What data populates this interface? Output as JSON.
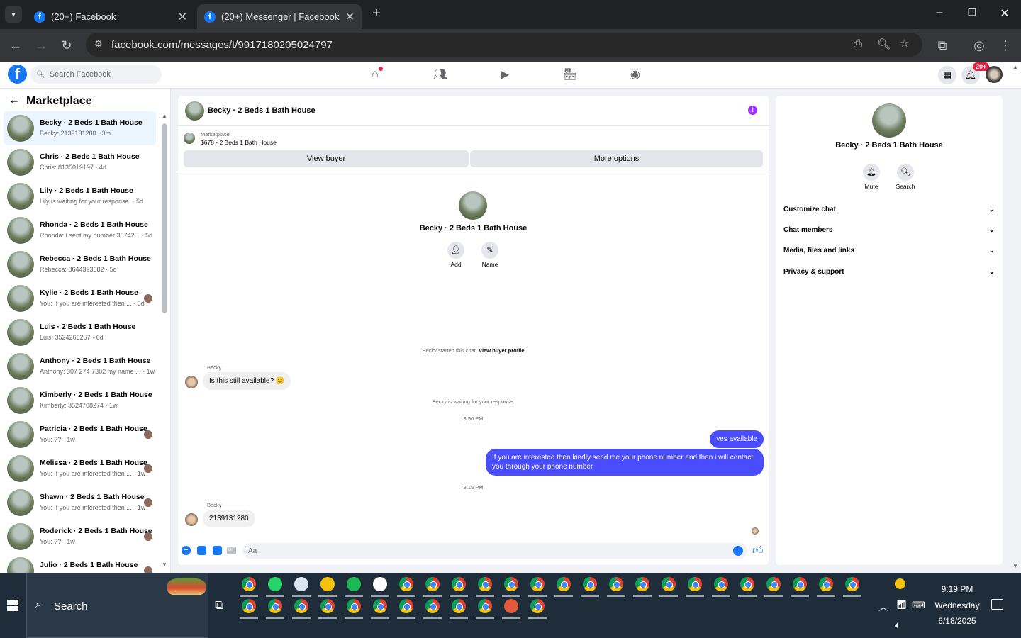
{
  "browser": {
    "tabs": [
      {
        "title": "(20+) Facebook",
        "active": false
      },
      {
        "title": "(20+) Messenger | Facebook",
        "active": true
      }
    ],
    "url": "facebook.com/messages/t/9917180205024797"
  },
  "header": {
    "search_placeholder": "Search Facebook",
    "notification_badge": "20+"
  },
  "sidebar": {
    "title": "Marketplace",
    "conversations": [
      {
        "name": "Becky · 2 Beds 1 Bath House",
        "preview": "Becky: 2139131280 · 3m",
        "selected": true
      },
      {
        "name": "Chris · 2 Beds 1 Bath House",
        "preview": "Chris: 8135019197 · 4d"
      },
      {
        "name": "Lily · 2 Beds 1 Bath House",
        "preview": "Lily is waiting for your response. · 5d"
      },
      {
        "name": "Rhonda · 2 Beds 1 Bath House",
        "preview": "Rhonda: I sent my number 30742... · 5d"
      },
      {
        "name": "Rebecca · 2 Beds 1 Bath House",
        "preview": "Rebecca: 8644323682 · 5d"
      },
      {
        "name": "Kylie · 2 Beds 1 Bath House",
        "preview": "You: If you are interested then ... · 5d",
        "seen": true
      },
      {
        "name": "Luis · 2 Beds 1 Bath House",
        "preview": "Luis: 3524266257 · 6d"
      },
      {
        "name": "Anthony · 2 Beds 1 Bath House",
        "preview": "Anthony: 307 274 7382 my name ... · 1w"
      },
      {
        "name": "Kimberly · 2 Beds 1 Bath House",
        "preview": "Kimberly: 3524708274 · 1w"
      },
      {
        "name": "Patricia · 2 Beds 1 Bath House",
        "preview": "You: ?? · 1w",
        "seen": true
      },
      {
        "name": "Melissa · 2 Beds 1 Bath House",
        "preview": "You: If you are interested then ... · 1w",
        "seen": true
      },
      {
        "name": "Shawn · 2 Beds 1 Bath House",
        "preview": "You: If you are interested then ... · 1w",
        "seen": true
      },
      {
        "name": "Roderick · 2 Beds 1 Bath House",
        "preview": "You: ?? · 1w",
        "seen": true
      },
      {
        "name": "Julio · 2 Beds 1 Bath House",
        "preview": "You: ?? · 1w",
        "seen": true
      }
    ]
  },
  "chat": {
    "title": "Becky · 2 Beds 1 Bath House",
    "listing_label": "Marketplace",
    "listing_title": "$678 - 2 Beds 1 Bath House",
    "view_buyer": "View buyer",
    "more_options": "More options",
    "profile_name": "Becky · 2 Beds 1 Bath House",
    "add_label": "Add",
    "name_label": "Name",
    "started_text": "Becky started this chat.",
    "view_profile": "View buyer profile",
    "sender": "Becky",
    "msg1": "Is this still available? 😊",
    "waiting": "Becky is waiting for your response.",
    "time1": "8:50 PM",
    "out1": "yes available",
    "out2": "If you are interested then kindly send me your phone number and then i will contact you through your phone number",
    "time2": "9:15 PM",
    "sender2": "Becky",
    "msg2": "2139131280",
    "input_placeholder": "Aa"
  },
  "details": {
    "name": "Becky · 2 Beds 1 Bath House",
    "mute": "Mute",
    "search": "Search",
    "rows": [
      "Customize chat",
      "Chat members",
      "Media, files and links",
      "Privacy & support"
    ]
  },
  "taskbar": {
    "search": "Search",
    "time": "9:19 PM",
    "day": "Wednesday",
    "date": "6/18/2025"
  },
  "colors": {
    "accent": "#1877f2",
    "outgoing": "#4a4dff",
    "selected": "#ebf5ff"
  }
}
